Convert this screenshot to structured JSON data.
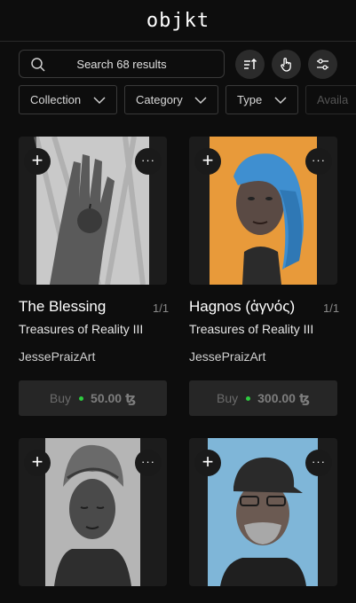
{
  "app": {
    "logo": "objkt"
  },
  "search": {
    "placeholder": "Search 68 results"
  },
  "toolbar": {
    "sort_icon": "sort-icon",
    "gesture_icon": "hand-pointer-icon",
    "filters_icon": "sliders-icon"
  },
  "filters": [
    {
      "label": "Collection"
    },
    {
      "label": "Category"
    },
    {
      "label": "Type"
    },
    {
      "label": "Availa"
    }
  ],
  "tokens": [
    {
      "title": "The Blessing",
      "edition": "1/1",
      "collection": "Treasures of Reality III",
      "artist": "JessePraizArt",
      "buy_label": "Buy",
      "price": "50.00",
      "currency": "ꜩ",
      "status_color": "#2ecc40"
    },
    {
      "title": "Hagnos (ἁγνός)",
      "edition": "1/1",
      "collection": "Treasures of Reality III",
      "artist": "JessePraizArt",
      "buy_label": "Buy",
      "price": "300.00",
      "currency": "ꜩ",
      "status_color": "#2ecc40"
    },
    {
      "title": "",
      "edition": "",
      "collection": "",
      "artist": "",
      "buy_label": "",
      "price": "",
      "currency": ""
    },
    {
      "title": "",
      "edition": "",
      "collection": "",
      "artist": "",
      "buy_label": "",
      "price": "",
      "currency": ""
    }
  ],
  "card_actions": {
    "add_symbol": "+",
    "more_symbol": "···"
  },
  "colors": {
    "background": "#0d0d0d",
    "button_bg": "#262626",
    "available_dot": "#2ecc40"
  }
}
